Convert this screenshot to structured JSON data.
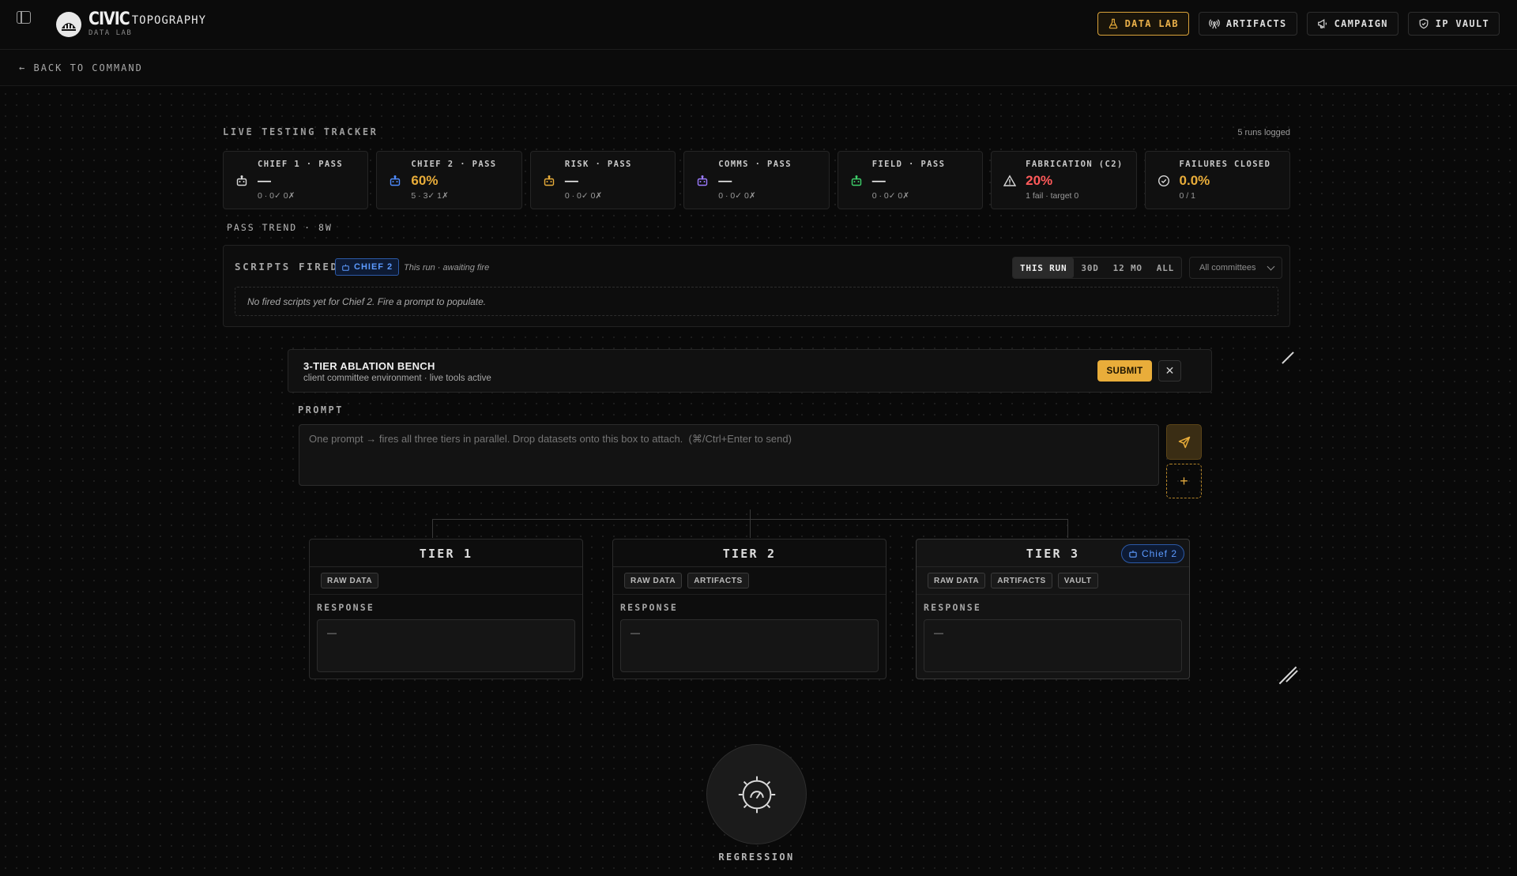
{
  "header": {
    "brand_bold": "CIVIC",
    "brand_rest": "TOPOGRAPHY",
    "brand_sub": "DATA LAB",
    "nav": [
      {
        "label": "DATA LAB",
        "icon": "flask-icon",
        "active": true
      },
      {
        "label": "ARTIFACTS",
        "icon": "broadcast-icon",
        "active": false
      },
      {
        "label": "CAMPAIGN",
        "icon": "megaphone-icon",
        "active": false
      },
      {
        "label": "IP VAULT",
        "icon": "shield-icon",
        "active": false
      }
    ]
  },
  "back_link": "BACK TO COMMAND",
  "tracker": {
    "title": "LIVE TESTING TRACKER",
    "runs_logged": "5 runs logged",
    "cards": [
      {
        "title": "CHIEF 1 · PASS",
        "value": "—",
        "sub": "0 · 0✓ 0✗",
        "icon": "bot-icon",
        "icon_color": "#d8d8d8",
        "value_color": "#f0f0f0"
      },
      {
        "title": "CHIEF 2 · PASS",
        "value": "60%",
        "sub": "5 · 3✓ 1✗",
        "icon": "bot-icon",
        "icon_color": "#4f8cff",
        "value_color": "#e9ad3a"
      },
      {
        "title": "RISK · PASS",
        "value": "—",
        "sub": "0 · 0✓ 0✗",
        "icon": "bot-icon",
        "icon_color": "#e9ad3a",
        "value_color": "#f0f0f0"
      },
      {
        "title": "COMMS · PASS",
        "value": "—",
        "sub": "0 · 0✓ 0✗",
        "icon": "bot-icon",
        "icon_color": "#9b7bff",
        "value_color": "#f0f0f0"
      },
      {
        "title": "FIELD · PASS",
        "value": "—",
        "sub": "0 · 0✓ 0✗",
        "icon": "bot-icon",
        "icon_color": "#3ecf6a",
        "value_color": "#f0f0f0"
      },
      {
        "title": "FABRICATION (C2)",
        "value": "20%",
        "sub": "1 fail · target 0",
        "icon": "warning-icon",
        "icon_color": "#d8d8d8",
        "value_color": "#ff5a5a"
      },
      {
        "title": "FAILURES CLOSED",
        "value": "0.0%",
        "sub": "0 / 1",
        "icon": "check-circle-icon",
        "icon_color": "#d8d8d8",
        "value_color": "#e9ad3a"
      }
    ]
  },
  "pass_trend": "PASS TREND · 8W",
  "scripts": {
    "title": "SCRIPTS FIRED",
    "badge": "CHIEF 2",
    "status": "This run · awaiting fire",
    "ranges": [
      "THIS RUN",
      "30D",
      "12 MO",
      "ALL"
    ],
    "active_range": "THIS RUN",
    "committee_select": "All committees",
    "empty": "No fired scripts yet for Chief 2. Fire a prompt to populate."
  },
  "bench": {
    "title": "3-TIER ABLATION BENCH",
    "subtitle": "client committee environment · live tools active",
    "submit": "SUBMIT",
    "close": "✕"
  },
  "prompt": {
    "label": "PROMPT",
    "placeholder": "One prompt → fires all three tiers in parallel. Drop datasets onto this box to attach.  (⌘/Ctrl+Enter to send)",
    "attach": "+"
  },
  "tiers": [
    {
      "name": "TIER 1",
      "tags": [
        "RAW DATA"
      ],
      "response_label": "RESPONSE",
      "response": "—",
      "chief": ""
    },
    {
      "name": "TIER 2",
      "tags": [
        "RAW DATA",
        "ARTIFACTS"
      ],
      "response_label": "RESPONSE",
      "response": "—",
      "chief": ""
    },
    {
      "name": "TIER 3",
      "tags": [
        "RAW DATA",
        "ARTIFACTS",
        "VAULT"
      ],
      "response_label": "RESPONSE",
      "response": "—",
      "chief": "Chief 2"
    }
  ],
  "regression": {
    "label": "REGRESSION",
    "icon": "gauge-icon"
  },
  "colors": {
    "accent": "#e9ad3a",
    "blue": "#4f8cff",
    "danger": "#ff5a5a"
  }
}
